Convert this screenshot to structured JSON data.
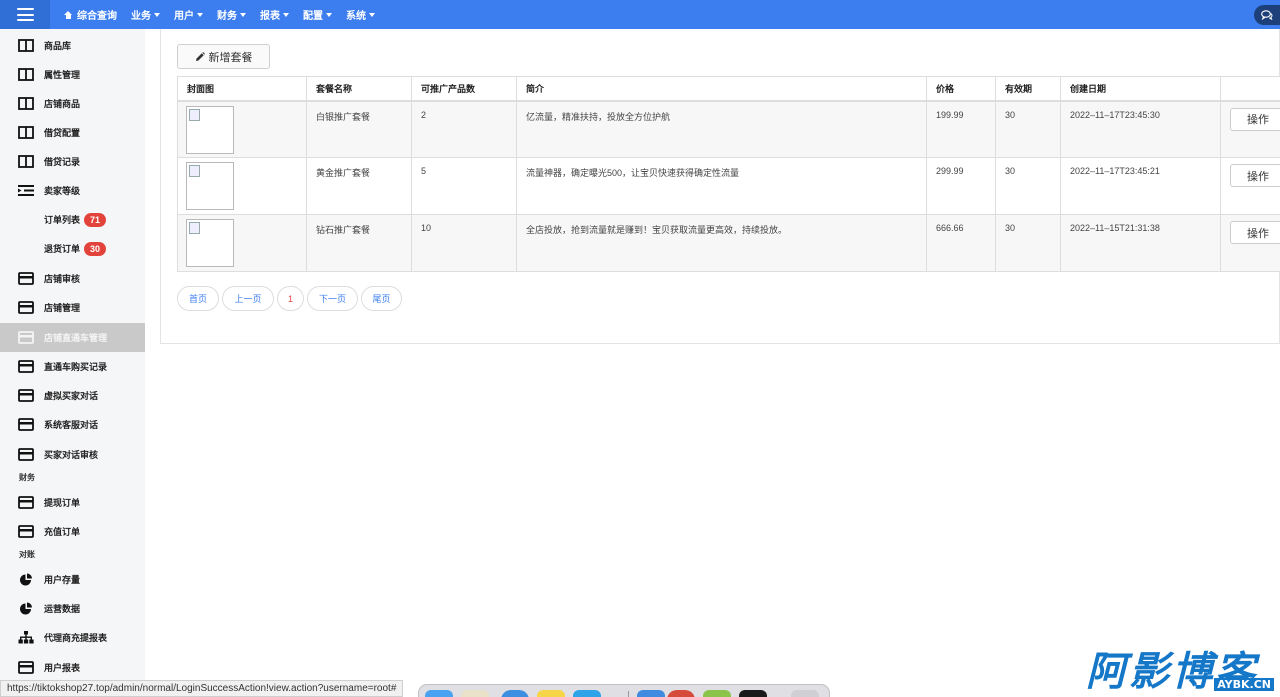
{
  "topbar": {
    "nav": [
      {
        "label": "综合查询",
        "icon": "home-icon",
        "caret": false
      },
      {
        "label": "业务",
        "caret": true
      },
      {
        "label": "用户",
        "caret": true
      },
      {
        "label": "财务",
        "caret": true
      },
      {
        "label": "报表",
        "caret": true
      },
      {
        "label": "配置",
        "caret": true
      },
      {
        "label": "系统",
        "caret": true
      }
    ],
    "accent": "#3c7ef0"
  },
  "sidebar": {
    "items": [
      {
        "label": "商品库",
        "icon": "book-icon"
      },
      {
        "label": "属性管理",
        "icon": "book-icon"
      },
      {
        "label": "店铺商品",
        "icon": "book-icon"
      },
      {
        "label": "借贷配置",
        "icon": "book-icon"
      },
      {
        "label": "借贷记录",
        "icon": "book-icon"
      },
      {
        "label": "卖家等级",
        "icon": "list-indent-icon"
      },
      {
        "label": "订单列表",
        "badge": "71",
        "sub": true
      },
      {
        "label": "退货订单",
        "badge": "30",
        "sub": true
      },
      {
        "label": "店铺审核",
        "icon": "card-icon"
      },
      {
        "label": "店铺管理",
        "icon": "card-icon"
      },
      {
        "label": "店铺直通车管理",
        "icon": "card-icon",
        "active": true
      },
      {
        "label": "直通车购买记录",
        "icon": "card-icon"
      },
      {
        "label": "虚拟买家对话",
        "icon": "card-icon"
      },
      {
        "label": "系统客服对话",
        "icon": "card-icon"
      },
      {
        "label": "买家对话审核",
        "icon": "card-icon"
      },
      {
        "label": "提现订单",
        "icon": "card-icon"
      },
      {
        "label": "充值订单",
        "icon": "card-icon"
      },
      {
        "label": "用户存量",
        "icon": "pie-chart-icon"
      },
      {
        "label": "运营数据",
        "icon": "pie-chart-icon"
      },
      {
        "label": "代理商充提报表",
        "icon": "sitemap-icon"
      },
      {
        "label": "用户报表",
        "icon": "card-icon"
      }
    ],
    "sections": {
      "finance": "财务",
      "reconcile": "对账"
    }
  },
  "main": {
    "add_button": "新增套餐",
    "columns": [
      "封面图",
      "套餐名称",
      "可推广产品数",
      "简介",
      "价格",
      "有效期",
      "创建日期",
      ""
    ],
    "rows": [
      {
        "name": "白银推广套餐",
        "count": "2",
        "desc": "亿流量，精准扶持，投放全方位护航",
        "price": "199.99",
        "days": "30",
        "date": "2022–11–17T23:45:30",
        "action": "操作"
      },
      {
        "name": "黄金推广套餐",
        "count": "5",
        "desc": "流量神器，确定曝光500，让宝贝快速获得确定性流量",
        "price": "299.99",
        "days": "30",
        "date": "2022–11–17T23:45:21",
        "action": "操作"
      },
      {
        "name": "钻石推广套餐",
        "count": "10",
        "desc": "全店投放，抢到流量就是赚到！宝贝获取流量更高效，持续投放。",
        "price": "666.66",
        "days": "30",
        "date": "2022–11–15T21:31:38",
        "action": "操作"
      }
    ],
    "pager": {
      "first": "首页",
      "prev": "上一页",
      "current": "1",
      "next": "下一页",
      "last": "尾页"
    }
  },
  "status_url": "https://tiktokshop27.top/admin/normal/LoginSuccessAction!view.action?username=root#",
  "watermark": {
    "big": "阿影博客",
    "small": "AYBK.CN"
  }
}
